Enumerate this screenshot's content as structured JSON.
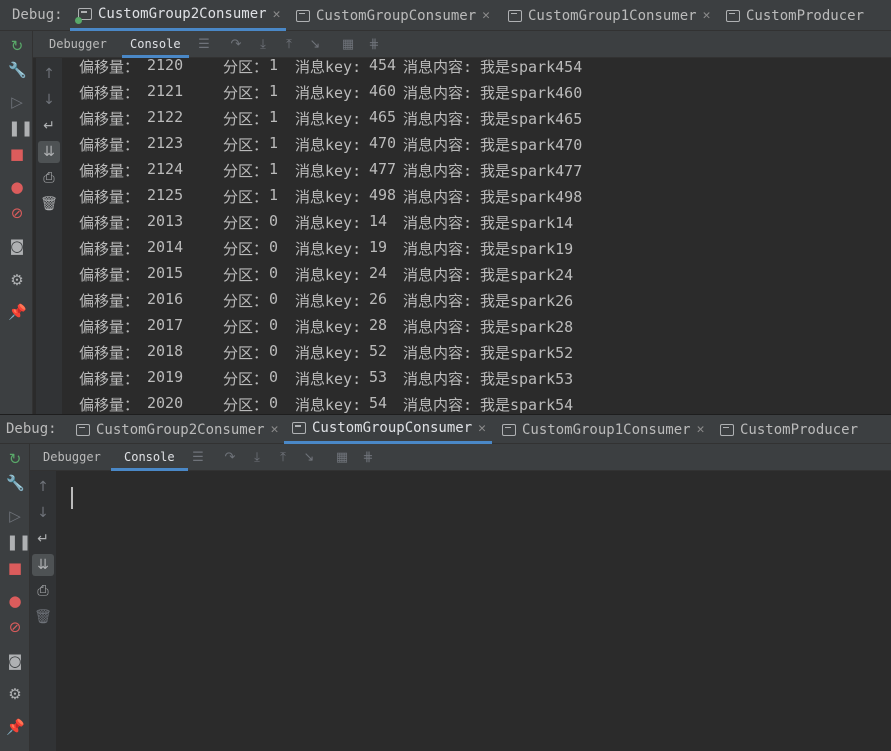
{
  "panels": [
    {
      "debug_label": "Debug:",
      "tabs": [
        {
          "label": "CustomGroup2Consumer",
          "active": true,
          "running": true
        },
        {
          "label": "CustomGroupConsumer",
          "active": false,
          "running": false
        },
        {
          "label": "CustomGroup1Consumer",
          "active": false,
          "running": false
        },
        {
          "label": "CustomProducer",
          "active": false,
          "running": false
        }
      ],
      "subtabs": [
        "Debugger",
        "Console"
      ],
      "active_subtab": "Console"
    },
    {
      "debug_label": "Debug:",
      "tabs": [
        {
          "label": "CustomGroup2Consumer",
          "active": false,
          "running": false
        },
        {
          "label": "CustomGroupConsumer",
          "active": true,
          "running": false
        },
        {
          "label": "CustomGroup1Consumer",
          "active": false,
          "running": false
        },
        {
          "label": "CustomProducer",
          "active": false,
          "running": false
        }
      ],
      "subtabs": [
        "Debugger",
        "Console"
      ],
      "active_subtab": "Console"
    }
  ],
  "icons": {
    "left_toolbar": [
      "rerun-icon",
      "wrench-icon",
      "resume-icon",
      "pause-icon",
      "stop-icon",
      "view-breakpoints-icon",
      "mute-breakpoints-icon",
      "camera-icon",
      "settings-icon",
      "pin-icon"
    ],
    "console_sidebar": [
      "up-arrow-icon",
      "down-arrow-icon",
      "soft-wrap-icon",
      "scroll-to-end-icon",
      "print-icon",
      "trash-icon"
    ],
    "toolbar": [
      "menu-icon",
      "step-over-icon",
      "step-into-icon",
      "step-out-icon",
      "run-to-cursor-icon",
      "table-icon",
      "frames-icon"
    ]
  },
  "colors": {
    "tab_accent": "#4a88c7",
    "rerun": "#59a869",
    "stop": "#db5c5c"
  },
  "console_labels": {
    "offset": "偏移量：",
    "partition": "分区：",
    "key": "消息key:",
    "content": "消息内容:"
  },
  "console1_lines": [
    {
      "offset": "2120",
      "partition": "1",
      "key": "454",
      "content": "我是spark454"
    },
    {
      "offset": "2121",
      "partition": "1",
      "key": "460",
      "content": "我是spark460"
    },
    {
      "offset": "2122",
      "partition": "1",
      "key": "465",
      "content": "我是spark465"
    },
    {
      "offset": "2123",
      "partition": "1",
      "key": "470",
      "content": "我是spark470"
    },
    {
      "offset": "2124",
      "partition": "1",
      "key": "477",
      "content": "我是spark477"
    },
    {
      "offset": "2125",
      "partition": "1",
      "key": "498",
      "content": "我是spark498"
    },
    {
      "offset": "2013",
      "partition": "0",
      "key": "14",
      "content": "我是spark14"
    },
    {
      "offset": "2014",
      "partition": "0",
      "key": "19",
      "content": "我是spark19"
    },
    {
      "offset": "2015",
      "partition": "0",
      "key": "24",
      "content": "我是spark24"
    },
    {
      "offset": "2016",
      "partition": "0",
      "key": "26",
      "content": "我是spark26"
    },
    {
      "offset": "2017",
      "partition": "0",
      "key": "28",
      "content": "我是spark28"
    },
    {
      "offset": "2018",
      "partition": "0",
      "key": "52",
      "content": "我是spark52"
    },
    {
      "offset": "2019",
      "partition": "0",
      "key": "53",
      "content": "我是spark53"
    },
    {
      "offset": "2020",
      "partition": "0",
      "key": "54",
      "content": "我是spark54"
    }
  ]
}
